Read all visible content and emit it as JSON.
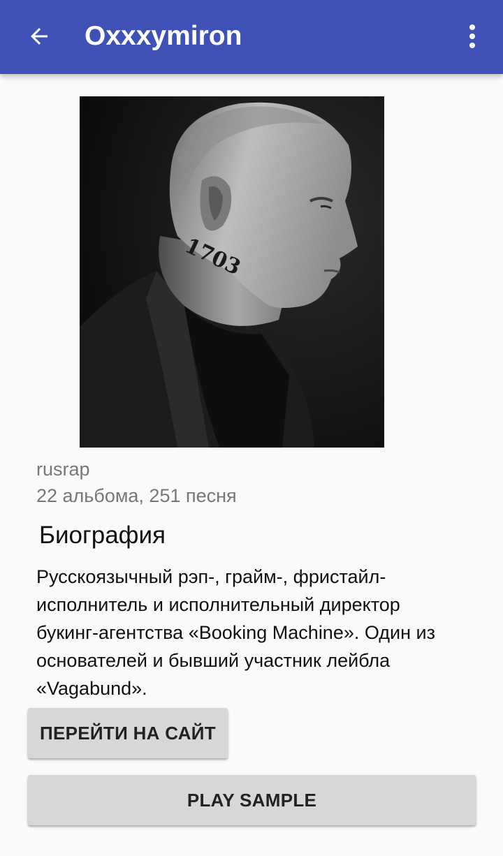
{
  "appbar": {
    "title": "Oxxxymiron",
    "back_icon": "arrow-left-icon",
    "menu_icon": "more-vert-icon",
    "color": "#3f51b5"
  },
  "artist": {
    "photo_tattoo": "1703",
    "genre": "rusrap",
    "counts": "22 альбома, 251 песня"
  },
  "biography": {
    "heading": "Биография",
    "text": "Русскоязычный рэп-, грайм-, фристайл-исполнитель и исполнительный директор букинг-агентства «Booking Machine». Один из основателей и бывший участник лейбла «Vagabund»."
  },
  "buttons": {
    "site_label": "ПЕРЕЙТИ НА САЙТ",
    "play_label": "PLAY SAMPLE"
  }
}
